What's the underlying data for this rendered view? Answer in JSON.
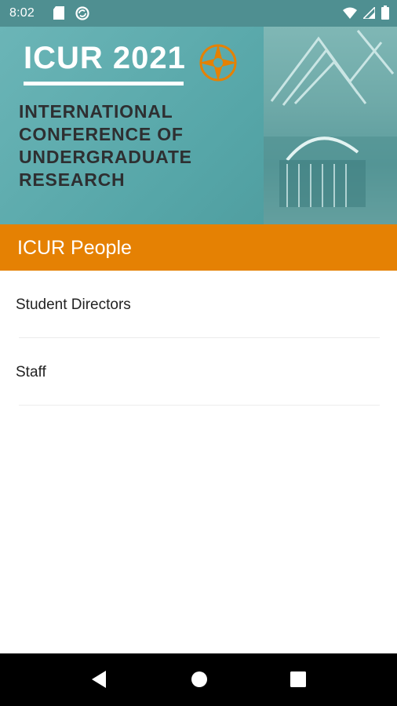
{
  "status_bar": {
    "time": "8:02",
    "left_icons": [
      "sd-card-icon",
      "sync-icon"
    ],
    "right_icons": [
      "wifi-icon",
      "signal-icon",
      "battery-icon"
    ]
  },
  "banner": {
    "title": "ICUR 2021",
    "subtitle": "INTERNATIONAL CONFERENCE OF UNDERGRADUATE RESEARCH",
    "logo_icon": "compass-rose-logo-icon",
    "accent_color": "#e58103"
  },
  "app_bar": {
    "title": "ICUR People",
    "color": "#e58103"
  },
  "list": {
    "items": [
      {
        "label": "Student Directors"
      },
      {
        "label": "Staff"
      }
    ]
  },
  "nav_bar": {
    "buttons": [
      "back-icon",
      "home-icon",
      "recents-icon"
    ]
  }
}
